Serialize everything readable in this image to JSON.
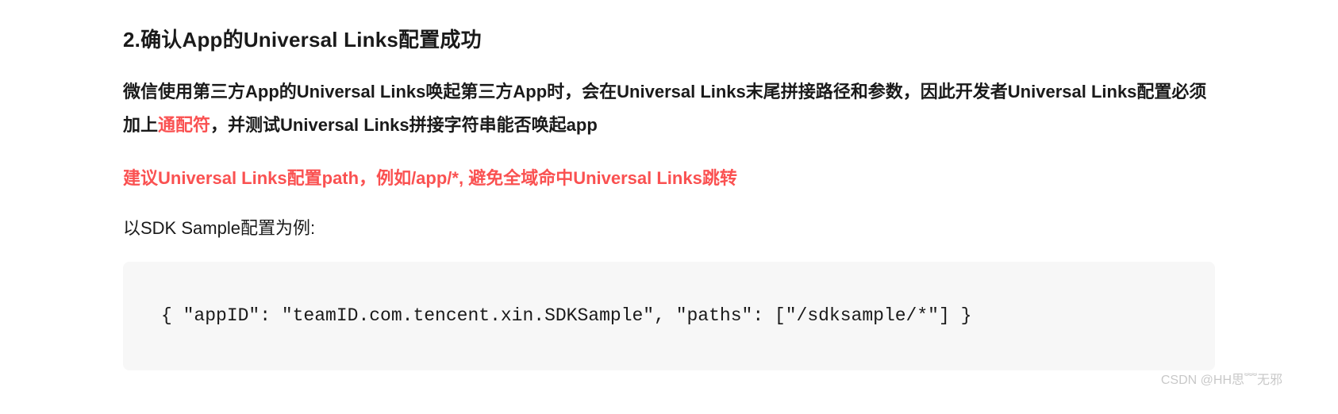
{
  "heading": "2.确认App的Universal Links配置成功",
  "paragraph": {
    "part1": "微信使用第三方App的Universal Links唤起第三方App时，会在Universal Links末尾拼接路径和参数，因此开发者Universal Links配置必须加上",
    "highlight": "通配符",
    "part2": "，并测试Universal Links拼接字符串能否唤起app"
  },
  "advice": "建议Universal Links配置path，例如/app/*, 避免全域命中Universal Links跳转",
  "example_label": "以SDK Sample配置为例:",
  "code": "{ \"appID\": \"teamID.com.tencent.xin.SDKSample\", \"paths\": [\"/sdksample/*\"] }",
  "watermark": "CSDN @HH思﹌无邪"
}
